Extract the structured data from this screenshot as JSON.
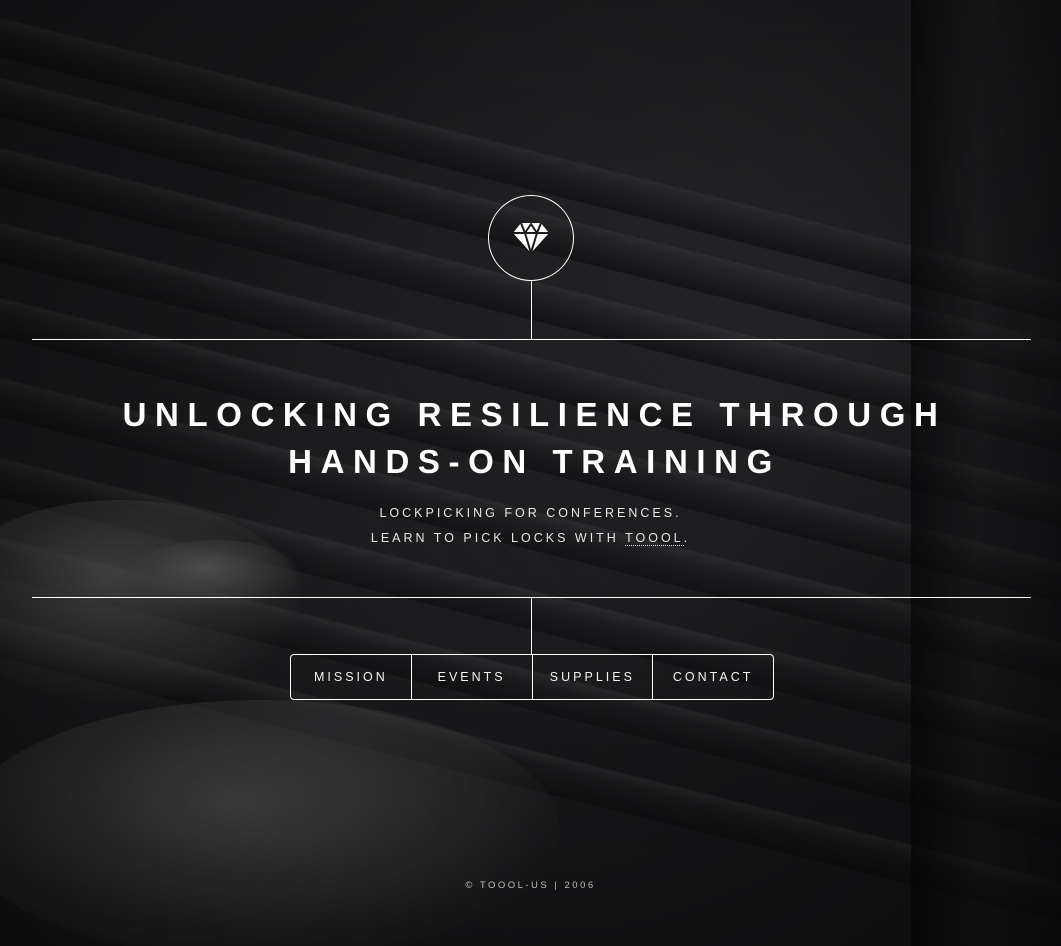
{
  "brand": {
    "logo_icon": "diamond-icon"
  },
  "hero": {
    "title_line1": "UNLOCKING RESILIENCE THROUGH",
    "title_line2": "HANDS-ON TRAINING",
    "tagline_line1": "LOCKPICKING FOR CONFERENCES.",
    "tagline_line2_prefix": "LEARN TO PICK LOCKS WITH ",
    "tagline_link": "TOOOL",
    "tagline_line2_suffix": "."
  },
  "nav": {
    "items": [
      {
        "label": "MISSION"
      },
      {
        "label": "EVENTS"
      },
      {
        "label": "SUPPLIES"
      },
      {
        "label": "CONTACT"
      }
    ]
  },
  "footer": {
    "copyright_symbol": "©",
    "text": "TOOOL-US",
    "separator": "|",
    "year": "2006"
  },
  "colors": {
    "foreground": "#ffffff",
    "background": "#1b1b1d"
  }
}
